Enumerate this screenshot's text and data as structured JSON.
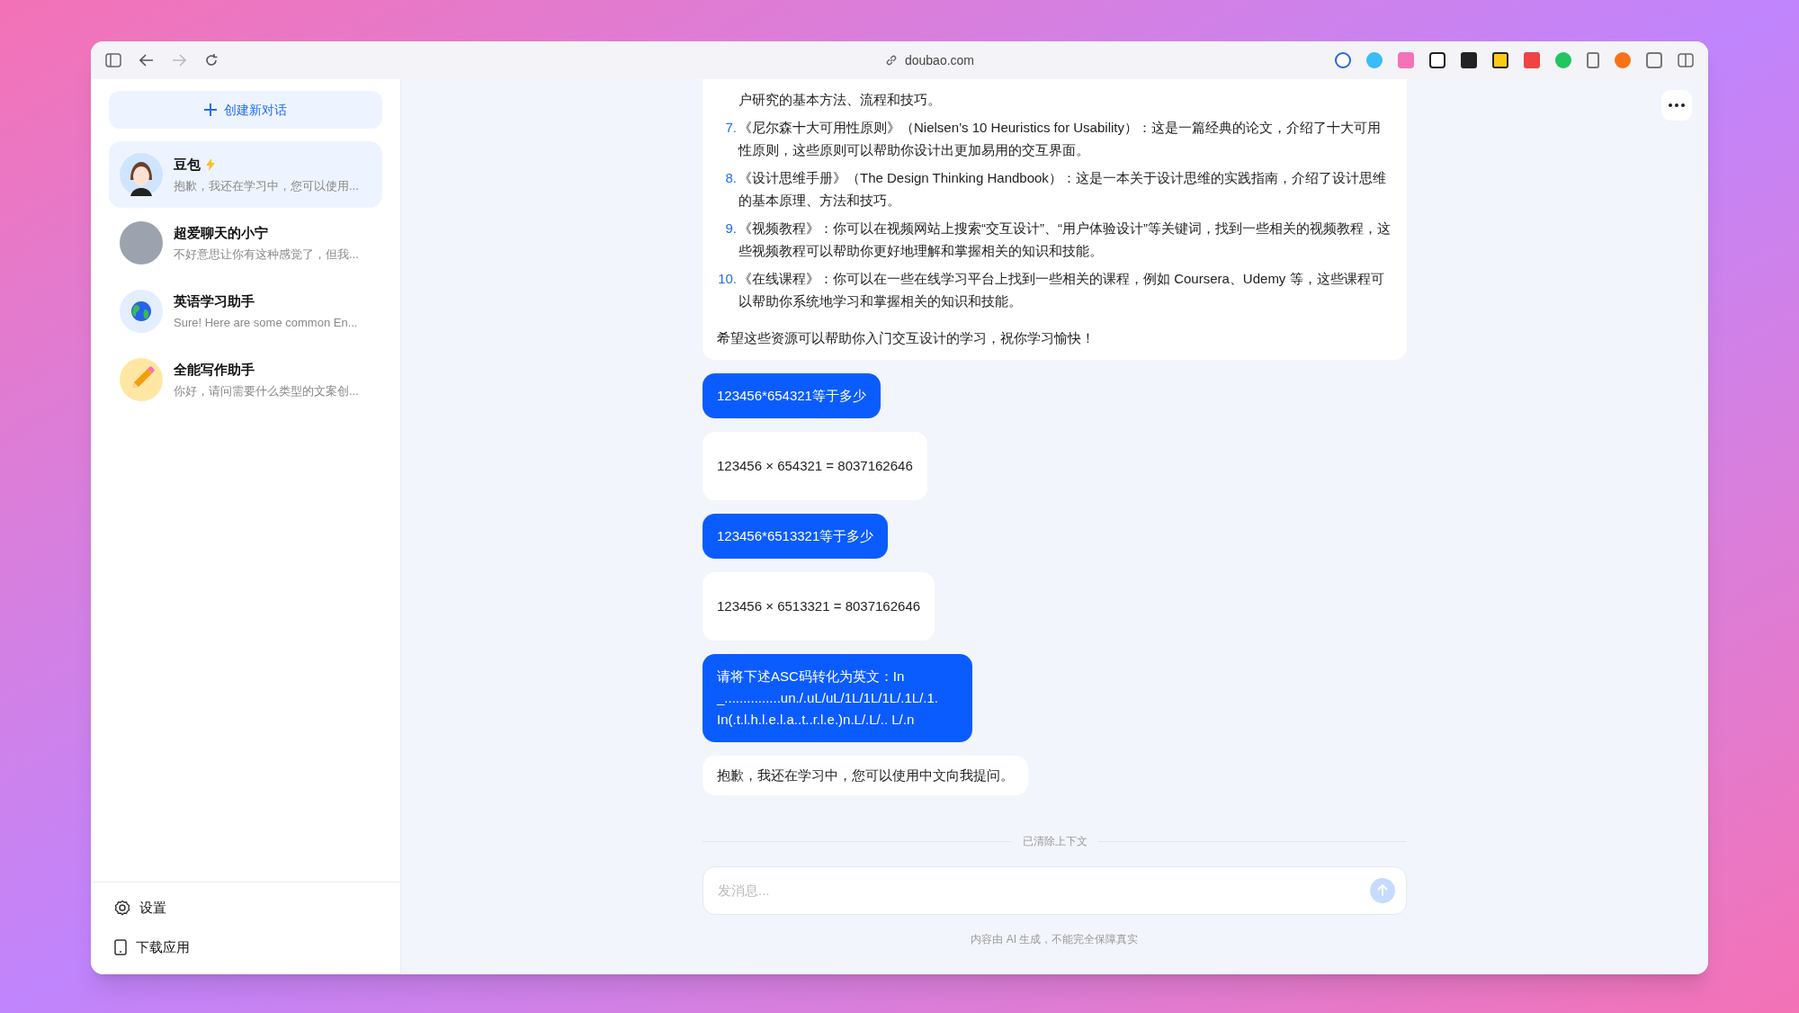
{
  "browser": {
    "url": "doubao.com"
  },
  "sidebar": {
    "new_chat": "创建新对话",
    "conversations": [
      {
        "name": "豆包",
        "preview": "抱歉，我还在学习中，您可以使用...",
        "kind": "cartoon",
        "badge": true,
        "selected": true
      },
      {
        "name": "超爱聊天的小宁",
        "preview": "不好意思让你有这种感觉了，但我...",
        "kind": "photo",
        "badge": false,
        "selected": false
      },
      {
        "name": "英语学习助手",
        "preview": "Sure! Here are some common En...",
        "kind": "globe",
        "badge": false,
        "selected": false
      },
      {
        "name": "全能写作助手",
        "preview": "你好，请问需要什么类型的文案创...",
        "kind": "pencil",
        "badge": false,
        "selected": false
      }
    ],
    "footer": [
      {
        "label": "设置",
        "kind": "settings"
      },
      {
        "label": "下载应用",
        "kind": "download"
      }
    ]
  },
  "chat": {
    "messages": [
      {
        "kind": "list",
        "continuation": "户研究的基本方法、流程和技巧。",
        "items": [
          {
            "number": "7.",
            "text": "《尼尔森十大可用性原则》（Nielsen’s 10 Heuristics for Usability）：这是一篇经典的论文，介绍了十大可用性原则，这些原则可以帮助你设计出更加易用的交互界面。"
          },
          {
            "number": "8.",
            "text": "《设计思维手册》（The Design Thinking Handbook）：这是一本关于设计思维的实践指南，介绍了设计思维的基本原理、方法和技巧。"
          },
          {
            "number": "9.",
            "text": "《视频教程》：你可以在视频网站上搜索“交互设计”、“用户体验设计”等关键词，找到一些相关的视频教程，这些视频教程可以帮助你更好地理解和掌握相关的知识和技能。"
          },
          {
            "number": "10.",
            "text": "《在线课程》：你可以在一些在线学习平台上找到一些相关的课程，例如 Coursera、Udemy 等，这些课程可以帮助你系统地学习和掌握相关的知识和技能。"
          }
        ],
        "closing": "希望这些资源可以帮助你入门交互设计的学习，祝你学习愉快！"
      },
      {
        "kind": "user",
        "text": "123456*654321等于多少"
      },
      {
        "kind": "answer",
        "text": "123456 × 654321 = 8037162646"
      },
      {
        "kind": "user",
        "text": "123456*6513321等于多少"
      },
      {
        "kind": "answer",
        "text": "123456 × 6513321 = 8037162646"
      },
      {
        "kind": "user",
        "text": "请将下述ASC码转化为英文：In _...............un./.uL/uL/1L/1L/1L/.1L/.1. In(.t.l.h.l.e.l.a..t..r.l.e.)n.L/.L/.. L/.n"
      },
      {
        "kind": "short",
        "text": "抱歉，我还在学习中，您可以使用中文向我提问。"
      }
    ],
    "divider": "已清除上下文",
    "input": {
      "placeholder": "发消息..."
    },
    "disclaimer": "内容由 AI 生成，不能完全保障真实"
  }
}
